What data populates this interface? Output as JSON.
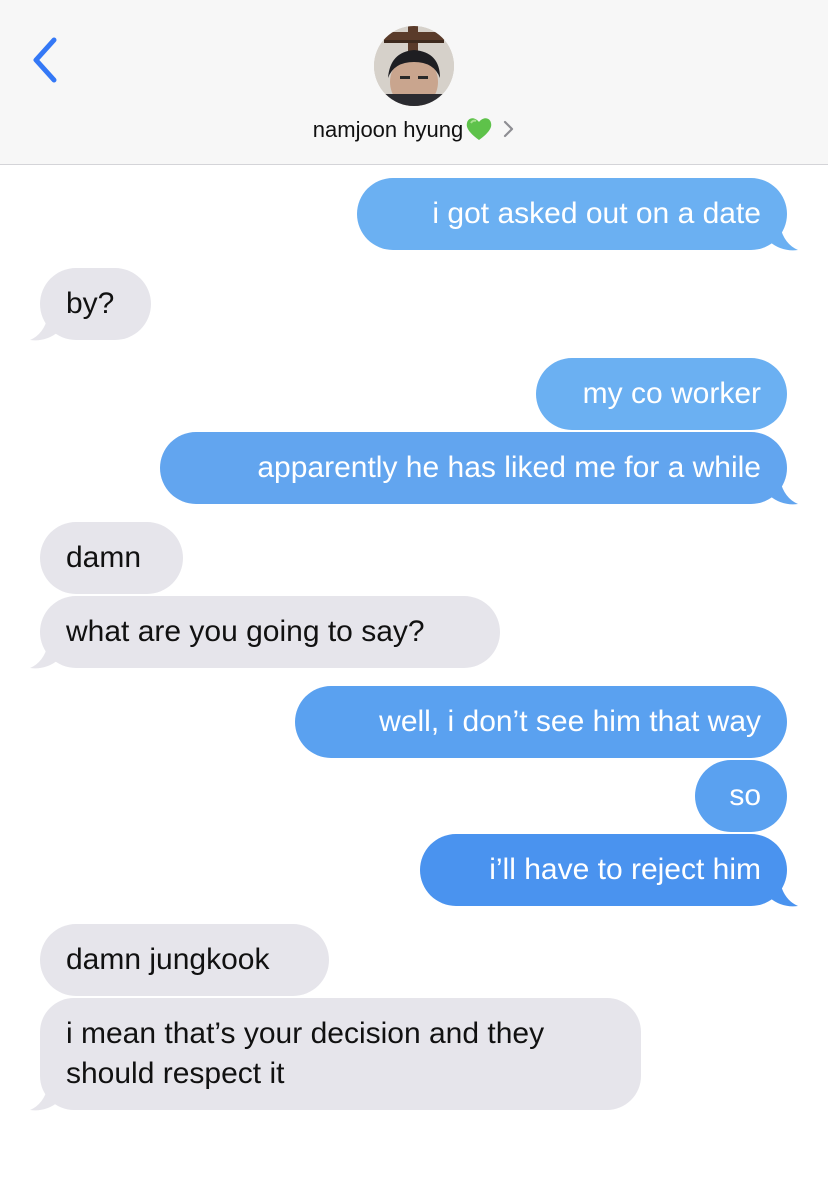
{
  "header": {
    "contact_name": "namjoon hyung",
    "heart_emoji": "💚",
    "icons": {
      "back": "chevron-left-icon",
      "details": "chevron-right-icon"
    },
    "accent_color": "#3478f6"
  },
  "messages": [
    {
      "direction": "sent",
      "text": "i got asked out on a date"
    },
    {
      "direction": "received",
      "text": "by?"
    },
    {
      "direction": "sent",
      "text": "my co worker"
    },
    {
      "direction": "sent",
      "text": "apparently he has liked me for a while"
    },
    {
      "direction": "received",
      "text": "damn"
    },
    {
      "direction": "received",
      "text": "what are you going to say?"
    },
    {
      "direction": "sent",
      "text": "well, i don’t see him that way"
    },
    {
      "direction": "sent",
      "text": "so"
    },
    {
      "direction": "sent",
      "text": "i’ll have to reject him"
    },
    {
      "direction": "received",
      "text": "damn jungkook"
    },
    {
      "direction": "received",
      "text": "i mean that’s your decision and they should respect it"
    }
  ],
  "colors": {
    "sent_bubble": "#5aa1f0",
    "received_bubble": "#e6e5eb",
    "header_bg": "#f7f7f7"
  }
}
